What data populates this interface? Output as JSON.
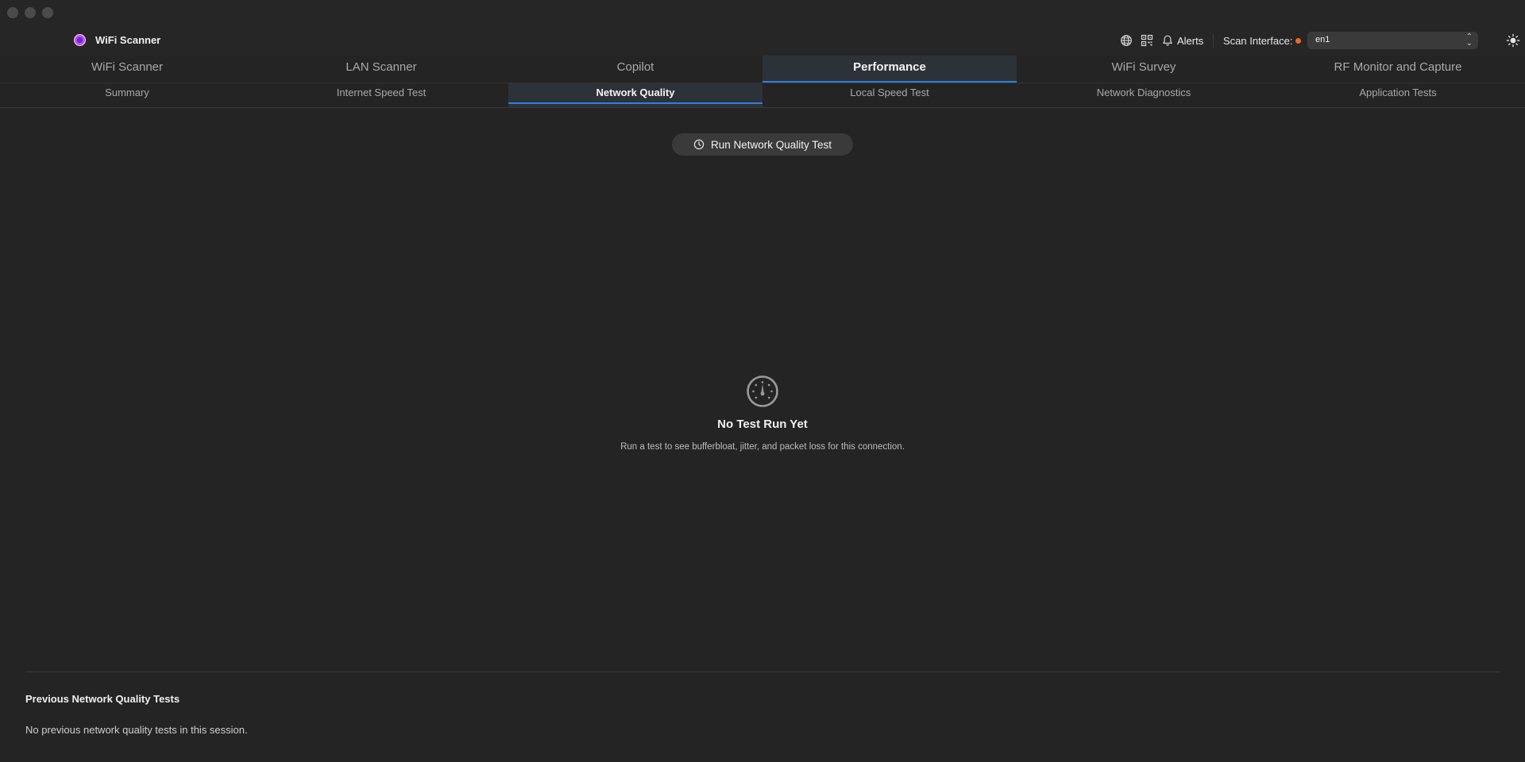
{
  "app": {
    "title": "WiFi Scanner"
  },
  "toolbar": {
    "alerts_label": "Alerts",
    "scan_interface_label": "Scan Interface:",
    "interface_value": "en1",
    "status_color": "#f2681b",
    "icons": [
      "globe-icon",
      "qr-code-icon",
      "bell-icon",
      "chevron-updown-icon",
      "sun-icon"
    ]
  },
  "tabs": [
    {
      "label": "WiFi Scanner",
      "active": false
    },
    {
      "label": "LAN Scanner",
      "active": false
    },
    {
      "label": "Copilot",
      "active": false
    },
    {
      "label": "Performance",
      "active": true
    },
    {
      "label": "WiFi Survey",
      "active": false
    },
    {
      "label": "RF Monitor and Capture",
      "active": false
    }
  ],
  "subtabs": [
    {
      "label": "Summary",
      "active": false
    },
    {
      "label": "Internet Speed Test",
      "active": false
    },
    {
      "label": "Network Quality",
      "active": true
    },
    {
      "label": "Local Speed Test",
      "active": false
    },
    {
      "label": "Network Diagnostics",
      "active": false
    },
    {
      "label": "Application Tests",
      "active": false
    }
  ],
  "main": {
    "run_button_label": "Run Network Quality Test",
    "empty_title": "No Test Run Yet",
    "empty_subtitle": "Run a test to see bufferbloat, jitter, and packet loss for this connection."
  },
  "history": {
    "title": "Previous Network Quality Tests",
    "empty_text": "No previous network quality tests in this session."
  },
  "colors": {
    "accent": "#2f7fe0",
    "background": "#242424"
  }
}
